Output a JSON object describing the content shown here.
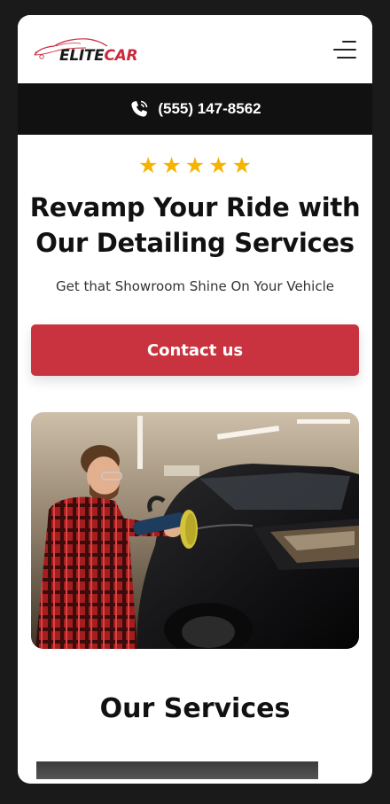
{
  "header": {
    "logo_elite": "ELITE",
    "logo_car": "CAR",
    "menu_icon": "hamburger-menu-icon"
  },
  "phonebar": {
    "icon": "phone-ringing-icon",
    "number": "(555) 147-8562"
  },
  "hero": {
    "rating": 5,
    "star_color": "#f5b400",
    "title_line1": "Revamp Your Ride with",
    "title_line2": "Our Detailing Services",
    "subtitle": "Get that Showroom Shine On Your Vehicle",
    "cta_label": "Contact us",
    "cta_color": "#c9333f"
  },
  "services": {
    "title": "Our Services"
  }
}
